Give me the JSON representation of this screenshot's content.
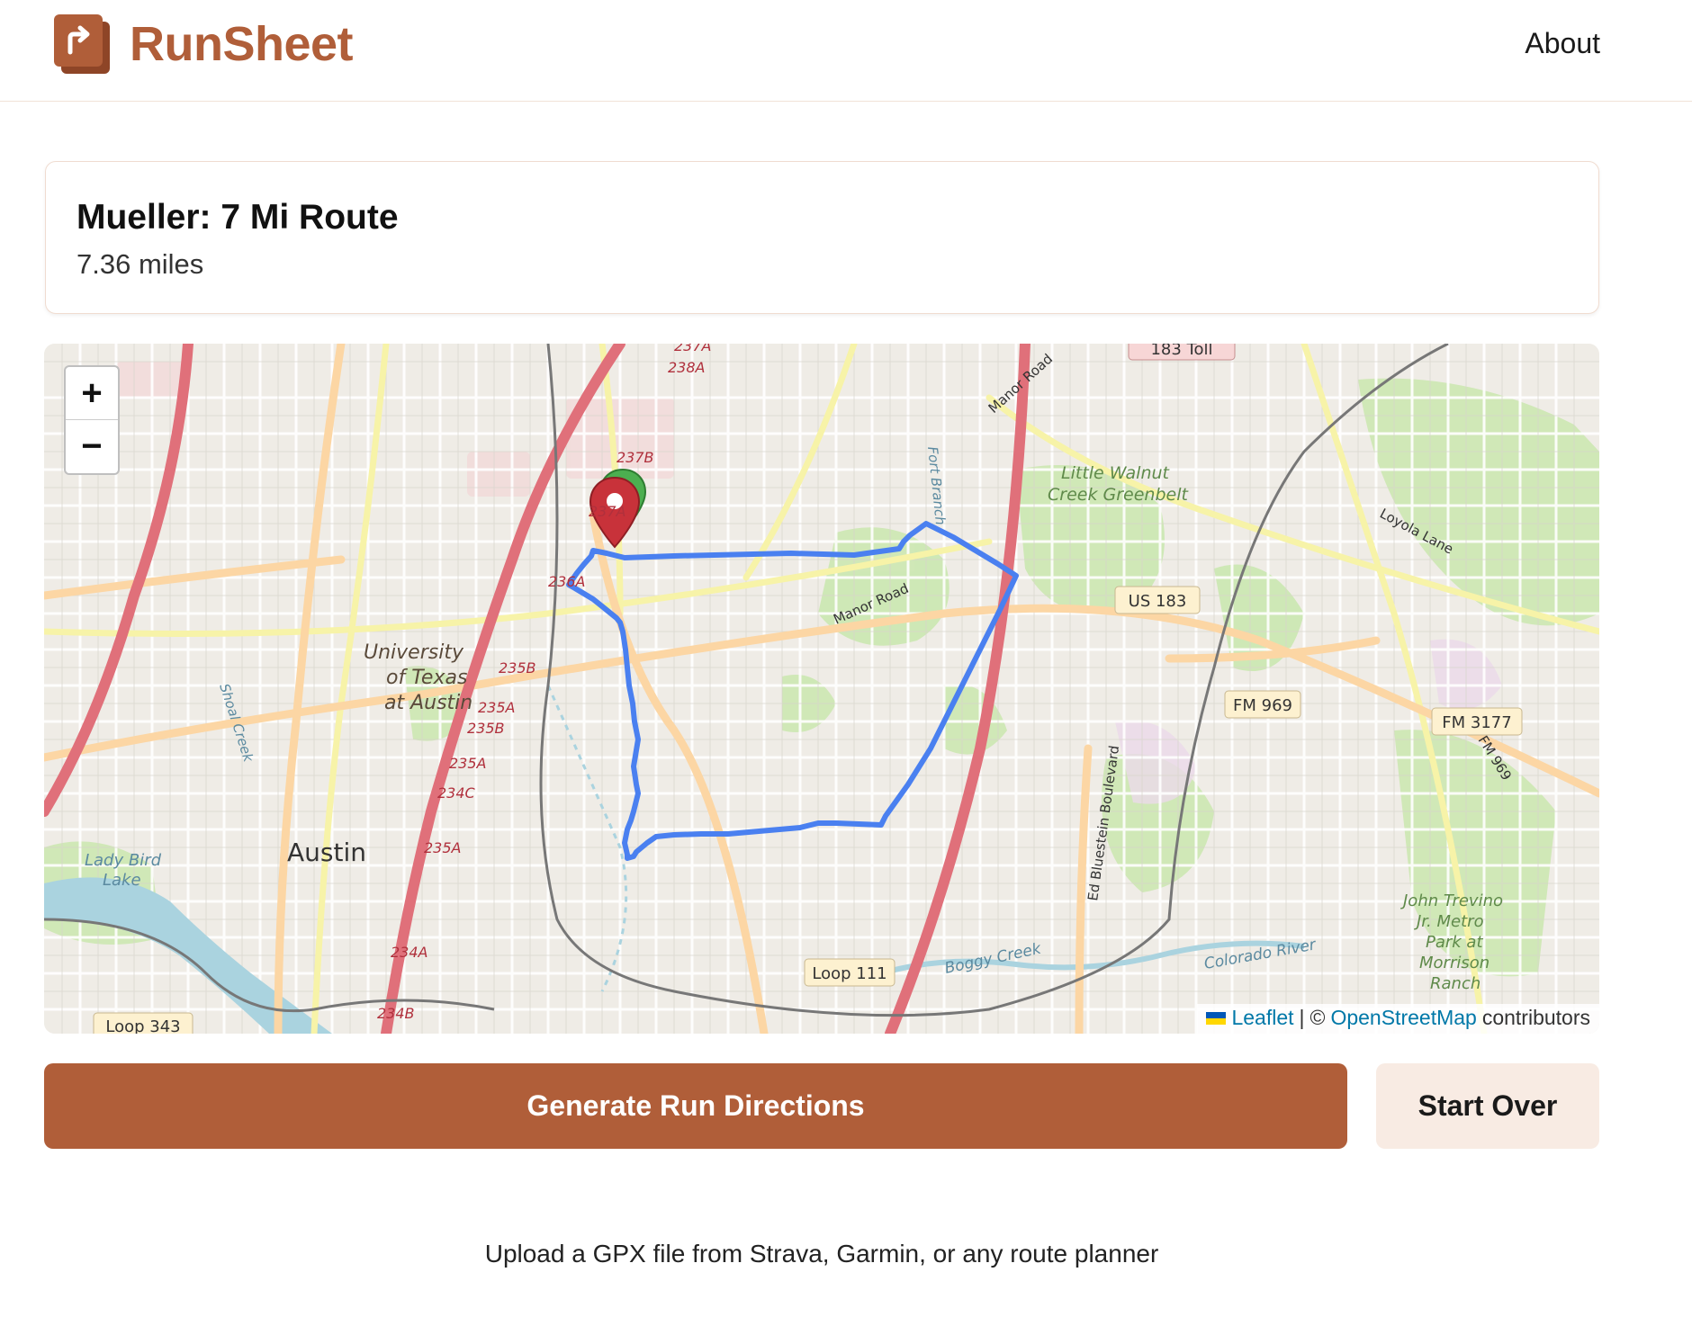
{
  "app": {
    "name": "RunSheet",
    "nav_about": "About"
  },
  "route": {
    "title": "Mueller: 7 Mi Route",
    "distance": "7.36 miles"
  },
  "map": {
    "zoom_in": "+",
    "zoom_out": "−",
    "attribution": {
      "leaflet": "Leaflet",
      "separator": "|",
      "copyright": "©",
      "osm": "OpenStreetMap",
      "contributors": "contributors"
    },
    "labels": {
      "university_1": "University",
      "university_2": "of Texas",
      "university_3": "at Austin",
      "austin": "Austin",
      "lady_bird_1": "Lady Bird",
      "lady_bird_2": "Lake",
      "little_walnut_1": "Little Walnut",
      "little_walnut_2": "Creek Greenbelt",
      "us183": "US 183",
      "fm969": "FM 969",
      "fm3177": "FM 3177",
      "loop111": "Loop 111",
      "loop343": "Loop 343",
      "toll183": "183 Toll",
      "manor_road": "Manor Road",
      "manor_road2": "Manor Road",
      "loyola": "Loyola Lane",
      "ed_bluestein": "Ed Bluestein Boulevard",
      "boggy": "Boggy Creek",
      "colorado": "Colorado River",
      "fort_branch": "Fort Branch",
      "shoal": "Shoal Creek",
      "fm969b": "FM 969",
      "john_1": "John Trevino",
      "john_2": "Jr. Metro",
      "john_3": "Park at",
      "john_4": "Morrison",
      "john_5": "Ranch",
      "x237a": "237A",
      "x238a": "238A",
      "x237b": "237B",
      "x237a2": "237A",
      "x236a": "236A",
      "x235b": "235B",
      "x235a": "235A",
      "x235b2": "235B",
      "x235a2": "235A",
      "x234c": "234C",
      "x235a3": "235A",
      "x234a": "234A",
      "x234b": "234B"
    }
  },
  "actions": {
    "generate": "Generate Run Directions",
    "start_over": "Start Over"
  },
  "footer": {
    "note": "Upload a GPX file from Strava, Garmin, or any route planner"
  },
  "colors": {
    "brand": "#b05e39",
    "brand_light": "#f8ebe3",
    "route": "#4a80f0",
    "marker_start": "#4caf50",
    "marker_end": "#c8323a"
  }
}
